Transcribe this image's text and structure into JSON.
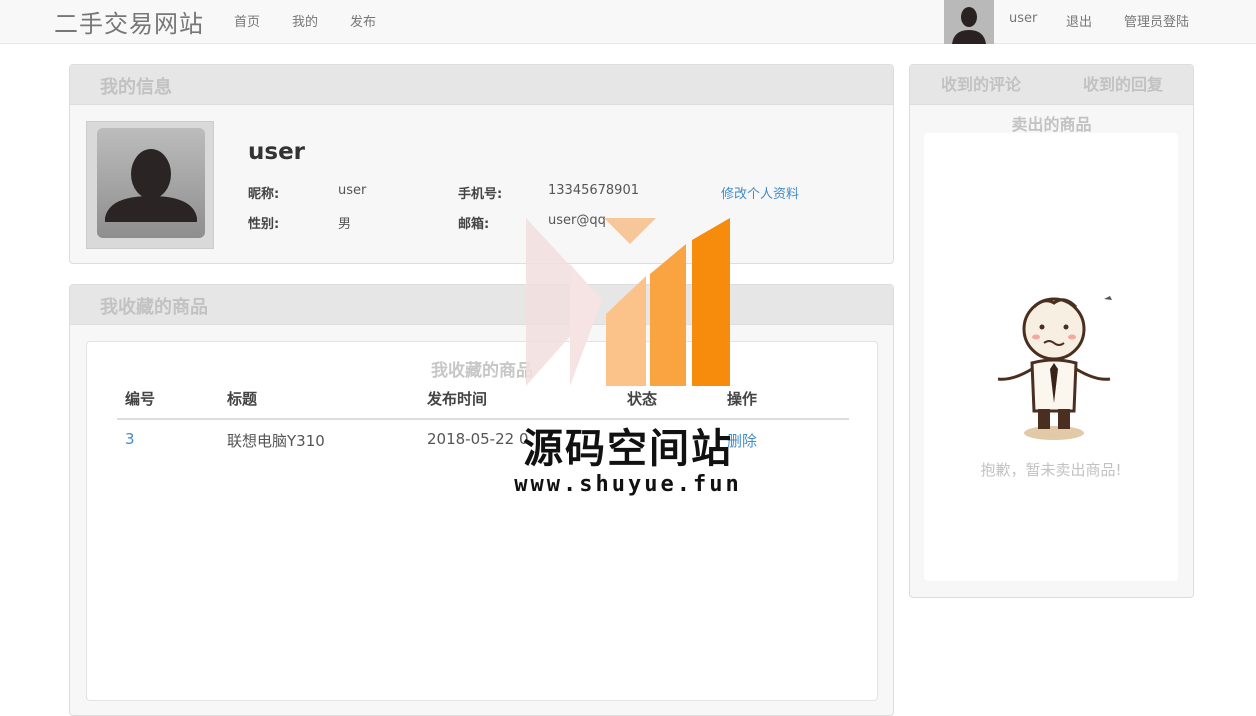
{
  "navbar": {
    "brand": "二手交易网站",
    "links": [
      "首页",
      "我的",
      "发布"
    ],
    "username": "user",
    "logout": "退出",
    "admin_login": "管理员登陆"
  },
  "info_panel": {
    "title": "我的信息",
    "username": "user",
    "nickname_label": "昵称:",
    "nickname": "user",
    "phone_label": "手机号:",
    "phone": "13345678901",
    "edit_link": "修改个人资料",
    "gender_label": "性别:",
    "gender": "男",
    "email_label": "邮箱:",
    "email": "user@qq"
  },
  "favorites_panel": {
    "title": "我收藏的商品",
    "inner_title": "我收藏的商品",
    "columns": [
      "编号",
      "标题",
      "发布时间",
      "状态",
      "操作"
    ],
    "rows": [
      {
        "id": "3",
        "title": "联想电脑Y310",
        "time": "2018-05-22 0",
        "action": "删除"
      }
    ]
  },
  "right_panel": {
    "tabs": [
      "收到的评论",
      "收到的回复"
    ],
    "sold_title": "卖出的商品",
    "empty_message": "抱歉，暂未卖出商品!"
  },
  "watermark": {
    "text": "源码空间站",
    "url": "www.shuyue.fun"
  },
  "colors": {
    "accent_link": "#428bca",
    "heading_bg": "#e6e6e6",
    "watermark_orange": "#f7931e"
  },
  "icons": [
    "default-avatar-icon",
    "confused-man-illustration",
    "watermark-logo"
  ]
}
